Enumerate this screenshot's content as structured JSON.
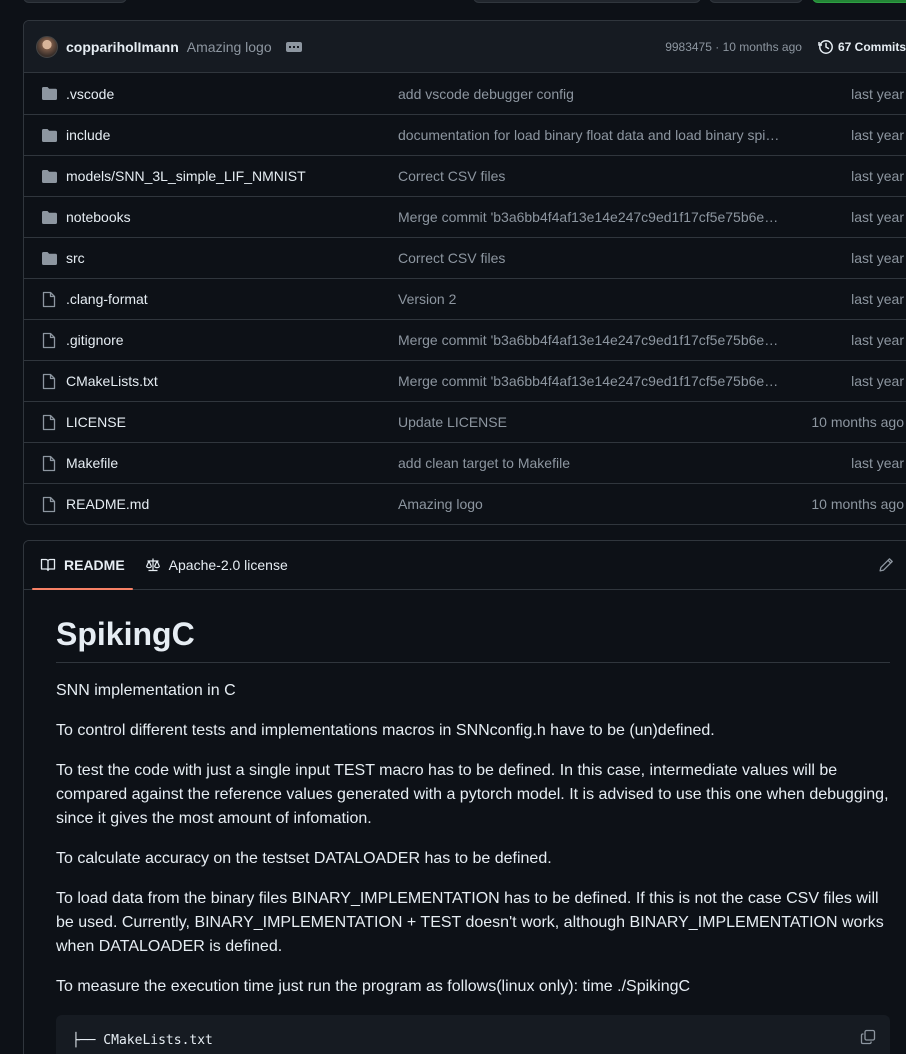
{
  "colors": {
    "bg": "#0d1117",
    "panel": "#161b22",
    "border": "#30363d",
    "text": "#e6edf3",
    "muted": "#8d96a0",
    "tab_accent": "#f78166",
    "folder": "#8d96a0"
  },
  "commit": {
    "author": "coppariholImann",
    "message": "Amazing logo",
    "meta": "9983475 · 10 months ago",
    "commits_label": "67 Commits"
  },
  "files": [
    {
      "name": ".vscode",
      "type": "folder",
      "message": "add vscode debugger config",
      "date": "last year"
    },
    {
      "name": "include",
      "type": "folder",
      "message": "documentation for load binary float data and load binary spi…",
      "date": "last year"
    },
    {
      "name": "models/SNN_3L_simple_LIF_NMNIST",
      "type": "folder",
      "message": "Correct CSV files",
      "date": "last year"
    },
    {
      "name": "notebooks",
      "type": "folder",
      "message": "Merge commit 'b3a6bb4f4af13e14e247c9ed1f17cf5e75b6ea…",
      "date": "last year"
    },
    {
      "name": "src",
      "type": "folder",
      "message": "Correct CSV files",
      "date": "last year"
    },
    {
      "name": ".clang-format",
      "type": "file",
      "message": "Version 2",
      "date": "last year"
    },
    {
      "name": ".gitignore",
      "type": "file",
      "message": "Merge commit 'b3a6bb4f4af13e14e247c9ed1f17cf5e75b6ea…",
      "date": "last year"
    },
    {
      "name": "CMakeLists.txt",
      "type": "file",
      "message": "Merge commit 'b3a6bb4f4af13e14e247c9ed1f17cf5e75b6ea…",
      "date": "last year"
    },
    {
      "name": "LICENSE",
      "type": "file",
      "message": "Update LICENSE",
      "date": "10 months ago"
    },
    {
      "name": "Makefile",
      "type": "file",
      "message": "add clean target to Makefile",
      "date": "last year"
    },
    {
      "name": "README.md",
      "type": "file",
      "message": "Amazing logo",
      "date": "10 months ago"
    }
  ],
  "readme": {
    "tabs": [
      {
        "label": "README",
        "icon": "book-icon"
      },
      {
        "label": "Apache-2.0 license",
        "icon": "scale-icon"
      }
    ],
    "title": "SpikingC",
    "paragraphs": [
      "SNN implementation in C",
      "To control different tests and implementations macros in SNNconfig.h have to be (un)defined.",
      "To test the code with just a single input TEST macro has to be defined. In this case, intermediate values will be compared against the reference values generated with a pytorch model. It is advised to use this one when debugging, since it gives the most amount of infomation.",
      "To calculate accuracy on the testset DATALOADER has to be defined.",
      "To load data from the binary files BINARY_IMPLEMENTATION has to be defined. If this is not the case CSV files will be used. Currently, BINARY_IMPLEMENTATION + TEST doesn't work, although BINARY_IMPLEMENTATION works when DATALOADER is defined.",
      "To measure the execution time just run the program as follows(linux only): time ./SpikingC"
    ],
    "code_first_line": "├── CMakeLists.txt"
  }
}
